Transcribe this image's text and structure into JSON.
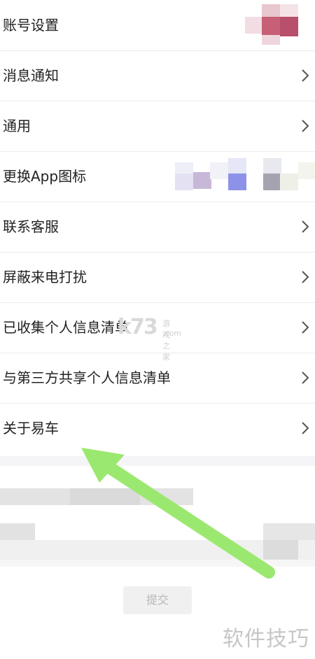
{
  "settings": {
    "items": [
      {
        "label": "账号设置",
        "chevron": false
      },
      {
        "label": "消息通知",
        "chevron": true
      },
      {
        "label": "通用",
        "chevron": true
      },
      {
        "label": "更换App图标",
        "chevron": false
      },
      {
        "label": "联系客服",
        "chevron": true
      },
      {
        "label": "屏蔽来电打扰",
        "chevron": true
      },
      {
        "label": "已收集个人信息清单",
        "chevron": true
      },
      {
        "label": "与第三方共享个人信息清单",
        "chevron": true
      },
      {
        "label": "关于易车",
        "chevron": true
      }
    ]
  },
  "account_avatar": {
    "blurred": true,
    "colors": [
      "#e9c7cf",
      "#c75f77",
      "#b84f6b",
      "#f2d9de"
    ]
  },
  "app_icons": {
    "blurred": true,
    "colors": [
      "#e8e6f3",
      "#c8b8d8",
      "#8d92e8",
      "#a6a3b0",
      "#eef0e8"
    ]
  },
  "submit_button": {
    "label": "提交"
  },
  "watermark": {
    "bottom_right": "软件技巧",
    "center_logo": "k73",
    "center_text": "游戏之家",
    "center_domain": ".com"
  },
  "colors": {
    "arrow": "#9be870",
    "chevron": "#555555",
    "divider": "#ececec"
  }
}
